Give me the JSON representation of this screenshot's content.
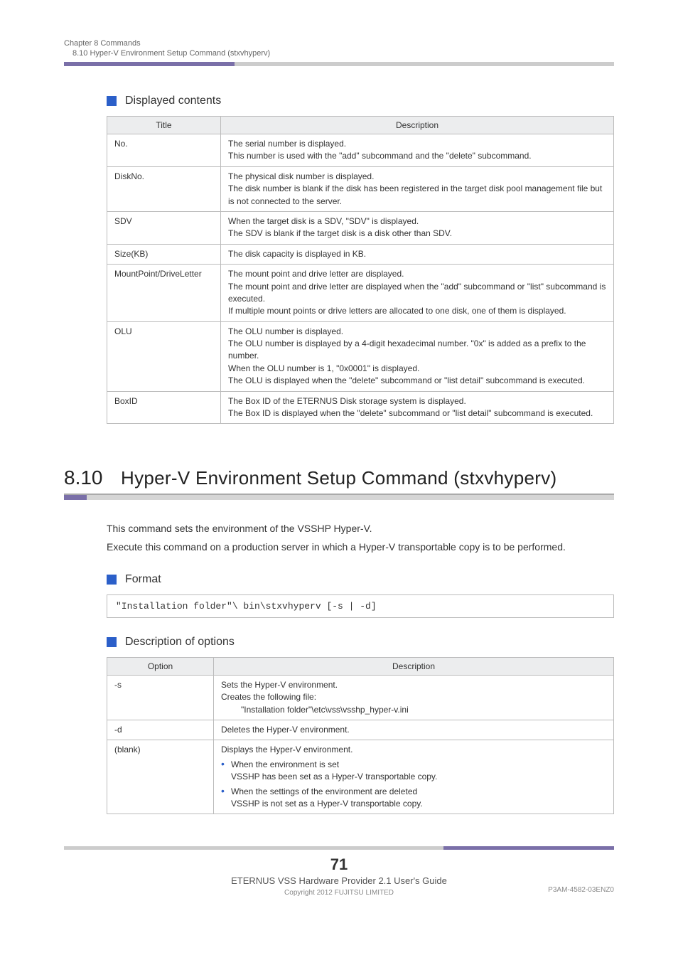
{
  "header": {
    "chapter": "Chapter 8  Commands",
    "section": "8.10  Hyper-V Environment Setup Command (stxvhyperv)"
  },
  "displayed_contents": {
    "heading": "Displayed contents",
    "columns": {
      "title": "Title",
      "description": "Description"
    },
    "rows": [
      {
        "title": "No.",
        "desc": "The serial number is displayed.\nThis number is used with the \"add\" subcommand and the \"delete\" subcommand."
      },
      {
        "title": "DiskNo.",
        "desc": "The physical disk number is displayed.\nThe disk number is blank if the disk has been registered in the target disk pool management file but is not connected to the server."
      },
      {
        "title": "SDV",
        "desc": "When the target disk is a SDV, \"SDV\" is displayed.\nThe SDV is blank if the target disk is a disk other than SDV."
      },
      {
        "title": "Size(KB)",
        "desc": "The disk capacity is displayed in KB."
      },
      {
        "title": "MountPoint/DriveLetter",
        "desc": "The mount point and drive letter are displayed.\nThe mount point and drive letter are displayed when the \"add\" subcommand or \"list\" subcommand is executed.\nIf multiple mount points or drive letters are allocated to one disk, one of them is displayed."
      },
      {
        "title": "OLU",
        "desc": "The OLU number is displayed.\nThe OLU number is displayed by a 4-digit hexadecimal number. \"0x\" is added as a prefix to the number.\nWhen the OLU number is 1, \"0x0001\" is displayed.\nThe OLU is displayed when the \"delete\" subcommand or \"list detail\" subcommand is executed."
      },
      {
        "title": "BoxID",
        "desc": "The Box ID of the ETERNUS Disk storage system is displayed.\nThe Box ID is displayed when the \"delete\" subcommand or \"list detail\" subcommand is executed."
      }
    ]
  },
  "main_section": {
    "number": "8.10",
    "title": "Hyper-V Environment Setup Command (stxvhyperv)",
    "intro1": "This command sets the environment of the VSSHP Hyper-V.",
    "intro2": "Execute this command on a production server in which a Hyper-V transportable copy is to be performed."
  },
  "format": {
    "heading": "Format",
    "code": "\"Installation folder\"\\ bin\\stxvhyperv [-s | -d]"
  },
  "options": {
    "heading": "Description of options",
    "columns": {
      "option": "Option",
      "description": "Description"
    },
    "rows": {
      "s": {
        "opt": "-s",
        "l1": "Sets the Hyper-V environment.",
        "l2": "Creates the following file:",
        "l3": "\"Installation folder\"\\etc\\vss\\vsshp_hyper-v.ini"
      },
      "d": {
        "opt": "-d",
        "desc": "Deletes the Hyper-V environment."
      },
      "blank": {
        "opt": "(blank)",
        "l1": "Displays the Hyper-V environment.",
        "b1": "When the environment is set",
        "b1s": "VSSHP has been set as a Hyper-V transportable copy.",
        "b2": "When the settings of the environment are deleted",
        "b2s": "VSSHP is not set as a Hyper-V transportable copy."
      }
    }
  },
  "footer": {
    "page": "71",
    "doc": "ETERNUS VSS Hardware Provider 2.1 User's Guide",
    "copyright": "Copyright 2012 FUJITSU LIMITED",
    "doccode": "P3AM-4582-03ENZ0"
  }
}
